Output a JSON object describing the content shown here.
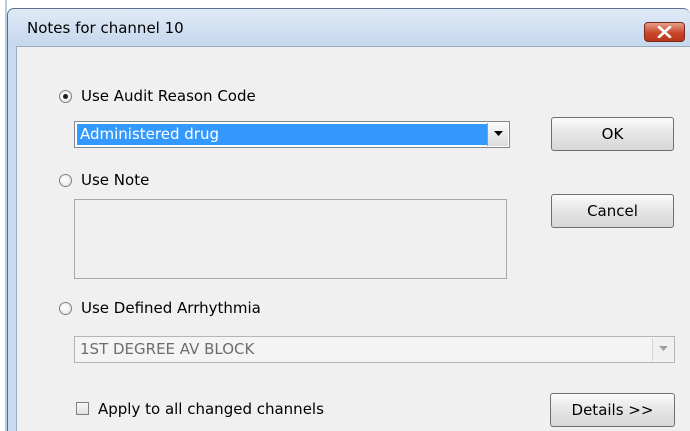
{
  "dialog": {
    "title": "Notes for channel 10",
    "close_icon": "close-x-icon",
    "close_color": "#c9462a"
  },
  "reason_code": {
    "label": "Use Audit Reason Code",
    "selected": true,
    "value": "Administered drug"
  },
  "note": {
    "label": "Use Note",
    "selected": false,
    "value": ""
  },
  "arrhythmia": {
    "label": "Use Defined Arrhythmia",
    "selected": false,
    "value": "1ST DEGREE AV BLOCK",
    "disabled": true
  },
  "apply_all": {
    "label": "Apply to all changed channels",
    "checked": false
  },
  "buttons": {
    "ok": "OK",
    "cancel": "Cancel",
    "details": "Details >>"
  },
  "colors": {
    "selection": "#3399ff",
    "frame": "#c8daf0",
    "client": "#f0f0f0"
  }
}
